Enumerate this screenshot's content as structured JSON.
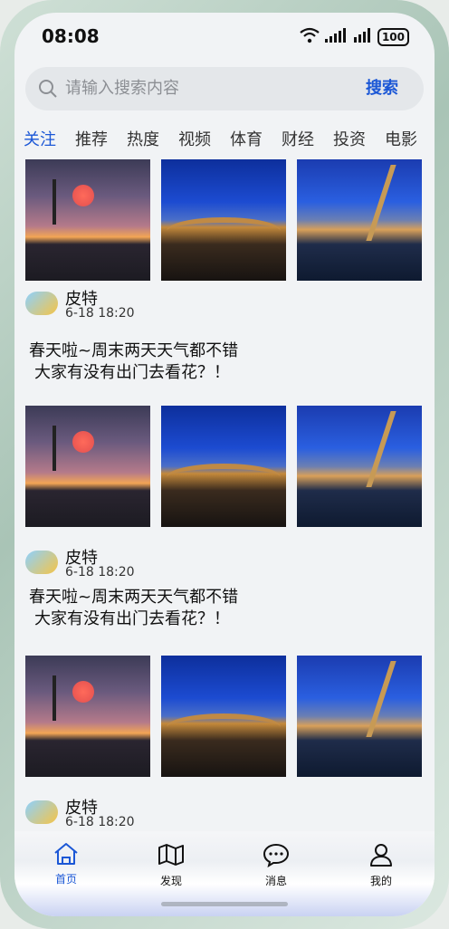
{
  "status": {
    "time": "08:08",
    "battery": "100"
  },
  "search": {
    "placeholder": "请输入搜索内容",
    "button": "搜索"
  },
  "tabs": [
    "关注",
    "推荐",
    "热度",
    "视频",
    "体育",
    "财经",
    "投资",
    "电影"
  ],
  "posts": [
    {
      "author": {
        "name": "皮特",
        "datetime": "6-18 18:20"
      },
      "text_line1": "春天啦~周末两天天气都不错",
      "text_line2": "大家有没有出门去看花？！"
    },
    {
      "author": {
        "name": "皮特",
        "datetime": "6-18 18:20"
      },
      "text_line1": "春天啦~周末两天天气都不错",
      "text_line2": "大家有没有出门去看花？！"
    },
    {
      "author": {
        "name": "皮特",
        "datetime": "6-18 18:20"
      }
    }
  ],
  "bottom_nav": [
    {
      "label": "首页",
      "icon": "home-icon"
    },
    {
      "label": "发现",
      "icon": "map-icon"
    },
    {
      "label": "消息",
      "icon": "message-icon"
    },
    {
      "label": "我的",
      "icon": "profile-icon"
    }
  ],
  "colors": {
    "accent": "#1b57d6"
  }
}
